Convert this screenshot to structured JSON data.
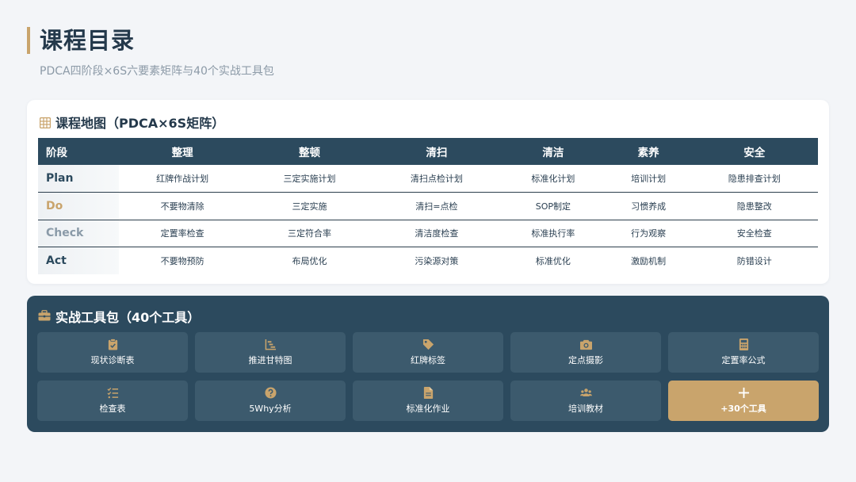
{
  "header": {
    "title": "课程目录",
    "subtitle": "PDCA四阶段×6S六要素矩阵与40个实战工具包"
  },
  "course_map": {
    "title": "课程地图（PDCA×6S矩阵）",
    "icon": "grid-icon",
    "columns": [
      "阶段",
      "整理",
      "整顿",
      "清扫",
      "清洁",
      "素养",
      "安全"
    ],
    "rows": [
      {
        "stage": "Plan",
        "color": "#2c4a5e",
        "cells": [
          "红牌作战计划",
          "三定实施计划",
          "清扫点检计划",
          "标准化计划",
          "培训计划",
          "隐患排查计划"
        ]
      },
      {
        "stage": "Do",
        "color": "#c9a46c",
        "cells": [
          "不要物清除",
          "三定实施",
          "清扫=点检",
          "SOP制定",
          "习惯养成",
          "隐患整改"
        ]
      },
      {
        "stage": "Check",
        "color": "#8a9aa8",
        "cells": [
          "定置率检查",
          "三定符合率",
          "清洁度检查",
          "标准执行率",
          "行为观察",
          "安全检查"
        ]
      },
      {
        "stage": "Act",
        "color": "#2c4a5e",
        "cells": [
          "不要物预防",
          "布局优化",
          "污染源对策",
          "标准优化",
          "激励机制",
          "防错设计"
        ]
      }
    ]
  },
  "toolkit": {
    "title": "实战工具包（40个工具）",
    "icon": "toolbox-icon",
    "tools": [
      {
        "label": "现状诊断表",
        "icon": "clipboard-icon"
      },
      {
        "label": "推进甘特图",
        "icon": "gantt-chart-icon"
      },
      {
        "label": "红牌标签",
        "icon": "tag-icon"
      },
      {
        "label": "定点摄影",
        "icon": "camera-icon"
      },
      {
        "label": "定置率公式",
        "icon": "calculator-icon"
      },
      {
        "label": "检查表",
        "icon": "checklist-icon"
      },
      {
        "label": "5Why分析",
        "icon": "question-icon"
      },
      {
        "label": "标准化作业",
        "icon": "document-icon"
      },
      {
        "label": "培训教材",
        "icon": "users-icon"
      },
      {
        "label": "+30个工具",
        "icon": "plus-icon"
      }
    ]
  },
  "colors": {
    "accent": "#c9a46c",
    "navy": "#2c4a5e",
    "tile": "#3c5a6d"
  }
}
